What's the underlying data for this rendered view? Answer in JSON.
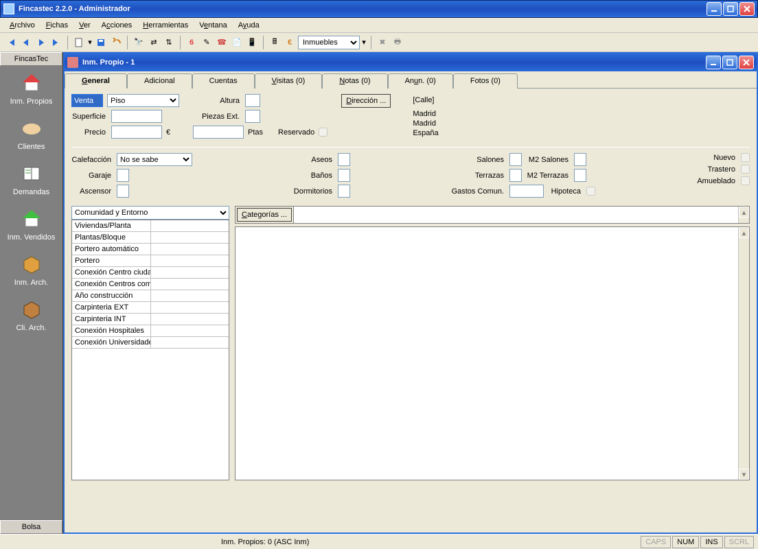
{
  "app": {
    "title": "Fincastec 2.2.0 - Administrador"
  },
  "menubar": {
    "archivo": "Archivo",
    "fichas": "Fichas",
    "ver": "Ver",
    "acciones": "Acciones",
    "herramientas": "Herramientas",
    "ventana": "Ventana",
    "ayuda": "Ayuda"
  },
  "toolbar": {
    "combo": "Inmuebles"
  },
  "sidebar": {
    "header": "FincasTec",
    "items": [
      {
        "label": "Inm. Propios"
      },
      {
        "label": "Clientes"
      },
      {
        "label": "Demandas"
      },
      {
        "label": "Inm. Vendidos"
      },
      {
        "label": "Inm. Arch."
      },
      {
        "label": "Cli. Arch."
      }
    ],
    "footer": "Bolsa"
  },
  "child": {
    "title": "Inm. Propio - 1",
    "tabs": {
      "general": "General",
      "adicional": "Adicional",
      "cuentas": "Cuentas",
      "visitas": "Visitas (0)",
      "notas": "Notas (0)",
      "anun": "Anun. (0)",
      "fotos": "Fotos (0)"
    }
  },
  "form": {
    "venta": "Venta",
    "piso": "Piso",
    "superficie_lbl": "Superficie",
    "precio_lbl": "Precio",
    "eur": "€",
    "ptas": "Ptas",
    "altura_lbl": "Altura",
    "piezas_lbl": "Piezas Ext.",
    "reservado_lbl": "Reservado",
    "direccion_btn": "Dirección ...",
    "addr_calle": "[Calle]",
    "addr_city1": "Madrid",
    "addr_city2": "Madrid",
    "addr_country": "España",
    "calefaccion_lbl": "Calefacción",
    "calefaccion_val": "No se sabe",
    "garaje_lbl": "Garaje",
    "ascensor_lbl": "Ascensor",
    "aseos_lbl": "Aseos",
    "banos_lbl": "Baños",
    "dormitorios_lbl": "Dormitorios",
    "salones_lbl": "Salones",
    "m2salones_lbl": "M2 Salones",
    "terrazas_lbl": "Terrazas",
    "m2terrazas_lbl": "M2 Terrazas",
    "gastos_lbl": "Gastos Comun.",
    "hipoteca_lbl": "Hipoteca",
    "nuevo_lbl": "Nuevo",
    "trastero_lbl": "Trastero",
    "amueblado_lbl": "Amueblado"
  },
  "proplist": {
    "category": "Comunidad y Entorno",
    "rows": [
      "Viviendas/Planta",
      "Plantas/Bloque",
      "Portero automático",
      "Portero",
      "Conexión Centro ciudad",
      "Conexión Centros com",
      "Año construcción",
      "Carpinteria EXT",
      "Carpinteria INT",
      "Conexión Hospitales",
      "Conexión Universidades"
    ]
  },
  "categorias_btn": "Categorías ...",
  "statusbar": {
    "main": "Inm. Propios: 0   (ASC Inm)",
    "caps": "CAPS",
    "num": "NUM",
    "ins": "INS",
    "scrl": "SCRL"
  }
}
